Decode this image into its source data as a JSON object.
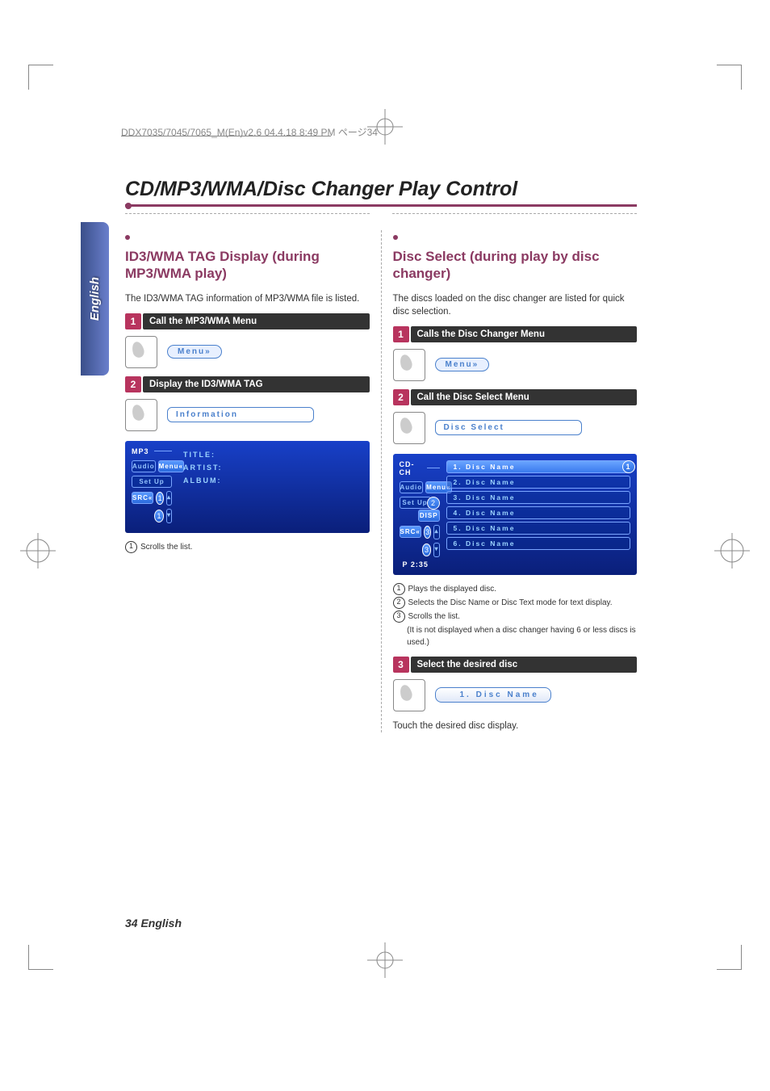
{
  "headerLine": "DDX7035/7045/7065_M(En)v2.6  04.4.18  8:49 PM  ページ34",
  "tabLabel": "English",
  "mainTitle": "CD/MP3/WMA/Disc Changer Play Control",
  "left": {
    "title": "ID3/WMA TAG Display (during MP3/WMA play)",
    "intro": "The ID3/WMA TAG information of MP3/WMA file is listed.",
    "step1": {
      "num": "1",
      "label": "Call the MP3/WMA Menu",
      "pill": "Menu»"
    },
    "step2": {
      "num": "2",
      "label": "Display the ID3/WMA TAG",
      "pill": "Information"
    },
    "screen": {
      "header": "MP3",
      "sideButtons": {
        "audio": "Audio",
        "setup": "Set Up",
        "src": "SRC«",
        "menu": "Menu«"
      },
      "fields": {
        "title": "TITLE:",
        "artist": "ARTIST:",
        "album": "ALBUM:"
      }
    },
    "notes": {
      "n1": "Scrolls the list."
    }
  },
  "right": {
    "title": "Disc Select (during play by disc changer)",
    "intro": "The discs loaded on the disc changer are listed for quick disc selection.",
    "step1": {
      "num": "1",
      "label": "Calls the Disc Changer Menu",
      "pill": "Menu»"
    },
    "step2": {
      "num": "2",
      "label": "Call the Disc Select Menu",
      "pill": "Disc  Select"
    },
    "screen": {
      "header": "CD-CH",
      "sideButtons": {
        "audio": "Audio",
        "setup": "Set Up",
        "src": "SRC«",
        "menu": "Menu«",
        "disp": "DISP"
      },
      "items": [
        "1. Disc Name",
        "2. Disc Name",
        "3. Disc Name",
        "4. Disc Name",
        "5. Disc Name",
        "6. Disc Name"
      ],
      "playTime": "P   2:35"
    },
    "notes": {
      "n1": "Plays the displayed disc.",
      "n2": "Selects the Disc Name or Disc Text mode for text display.",
      "n3": "Scrolls the list.",
      "n3b": "(It is not displayed when a disc changer having 6 or less discs is used.)"
    },
    "step3": {
      "num": "3",
      "label": "Select the desired disc",
      "pill": "1. Disc  Name"
    },
    "outro": "Touch the desired disc display."
  },
  "footer": "34 English"
}
